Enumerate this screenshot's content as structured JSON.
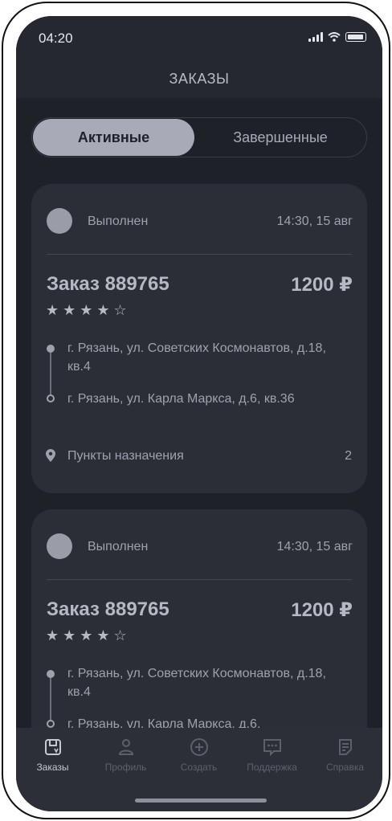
{
  "status_bar": {
    "time": "04:20"
  },
  "header": {
    "title": "ЗАКАЗЫ"
  },
  "tabs": {
    "active": "Активные",
    "inactive": "Завершенные"
  },
  "orders": [
    {
      "status": "Выполнен",
      "time": "14:30, 15 авг",
      "title": "Заказ 889765",
      "price": "1200 ₽",
      "rating": 4,
      "stars_text": "★ ★ ★ ★ ☆",
      "address_from": "г. Рязань, ул. Советских Космонавтов, д.18, кв.4",
      "address_to": "г. Рязань, ул. Карла Маркса, д.6, кв.36",
      "destinations_label": "Пункты назначения",
      "destinations_count": "2"
    },
    {
      "status": "Выполнен",
      "time": "14:30, 15 авг",
      "title": "Заказ 889765",
      "price": "1200 ₽",
      "rating": 4,
      "stars_text": "★ ★ ★ ★ ☆",
      "address_from": "г. Рязань, ул. Советских Космонавтов, д.18, кв.4",
      "address_to": "г. Рязань, ул. Карла Маркса, д.6,"
    }
  ],
  "bottom_nav": [
    {
      "label": "Заказы",
      "icon": "orders-icon",
      "active": true
    },
    {
      "label": "Профиль",
      "icon": "profile-icon",
      "active": false
    },
    {
      "label": "Создать",
      "icon": "plus-circle-icon",
      "active": false
    },
    {
      "label": "Поддержка",
      "icon": "chat-icon",
      "active": false
    },
    {
      "label": "Справка",
      "icon": "document-icon",
      "active": false
    }
  ],
  "colors": {
    "background": "#1f2129",
    "card": "#2b2d37",
    "accent": "#a8aab7",
    "text_muted": "#9fa1ad",
    "nav_inactive": "#5d606c"
  }
}
